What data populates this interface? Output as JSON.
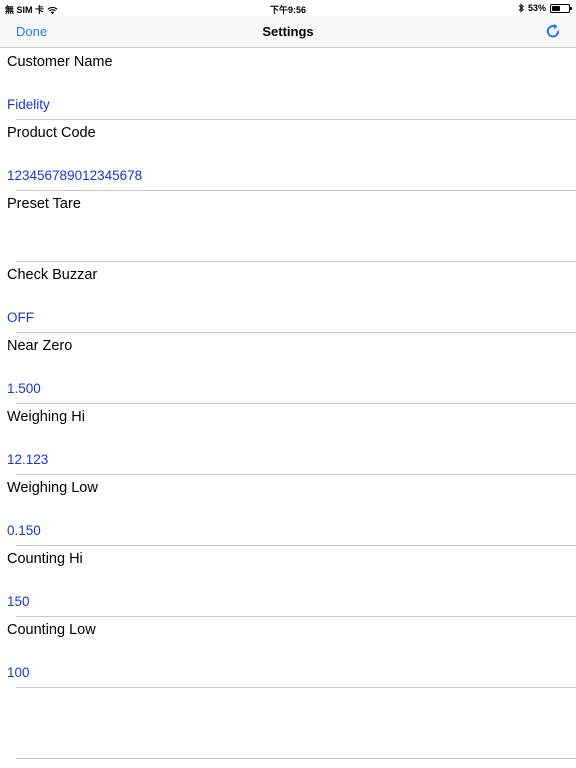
{
  "status_bar": {
    "carrier": "無 SIM 卡",
    "time": "下午9:56",
    "battery_percent": "53%",
    "battery_level": 0.53
  },
  "nav": {
    "done_label": "Done",
    "title": "Settings",
    "accent_color": "#1f7bf5"
  },
  "settings": [
    {
      "label": "Customer Name",
      "value": "Fidelity"
    },
    {
      "label": "Product Code",
      "value": "123456789012345678"
    },
    {
      "label": "Preset Tare",
      "value": ""
    },
    {
      "label": "Check Buzzar",
      "value": "OFF"
    },
    {
      "label": "Near Zero",
      "value": "1.500"
    },
    {
      "label": "Weighing Hi",
      "value": "12.123"
    },
    {
      "label": "Weighing Low",
      "value": "0.150"
    },
    {
      "label": "Counting Hi",
      "value": "150"
    },
    {
      "label": "Counting Low",
      "value": "100"
    }
  ],
  "value_color": "#1a35d8"
}
